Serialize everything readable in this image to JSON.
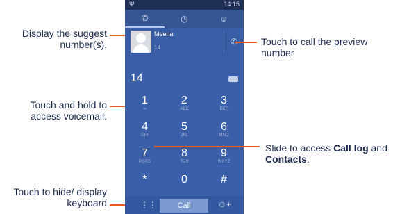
{
  "status": {
    "left": "Ψ",
    "right": "14:15"
  },
  "tabs": [
    {
      "icon": "phone-icon",
      "glyph": "✆"
    },
    {
      "icon": "clock-icon",
      "glyph": "◷"
    },
    {
      "icon": "contacts-icon",
      "glyph": "☺"
    }
  ],
  "suggest": {
    "name": "Meena",
    "number": "14"
  },
  "dial": {
    "digits": "14"
  },
  "keys": [
    {
      "n": "1",
      "l": "∞"
    },
    {
      "n": "2",
      "l": "ABC"
    },
    {
      "n": "3",
      "l": "DEF"
    },
    {
      "n": "4",
      "l": "GHI"
    },
    {
      "n": "5",
      "l": "JKL"
    },
    {
      "n": "6",
      "l": "MNO"
    },
    {
      "n": "7",
      "l": "PQRS"
    },
    {
      "n": "8",
      "l": "TUV"
    },
    {
      "n": "9",
      "l": "WXYZ"
    },
    {
      "n": "*",
      "l": ""
    },
    {
      "n": "0",
      "l": ""
    },
    {
      "n": "#",
      "l": ""
    }
  ],
  "bottom": {
    "call": "Call"
  },
  "annotations": {
    "a1": "Display the suggest number(s).",
    "a2": "Touch and hold to access voicemail.",
    "a3": "Touch to hide/ display keyboard",
    "a4": "Touch to call the preview number",
    "a5_prefix": "Slide to access",
    "a5_calllog": "Call log",
    "a5_and": "and",
    "a5_contacts": "Contacts",
    "a5_end": "."
  }
}
